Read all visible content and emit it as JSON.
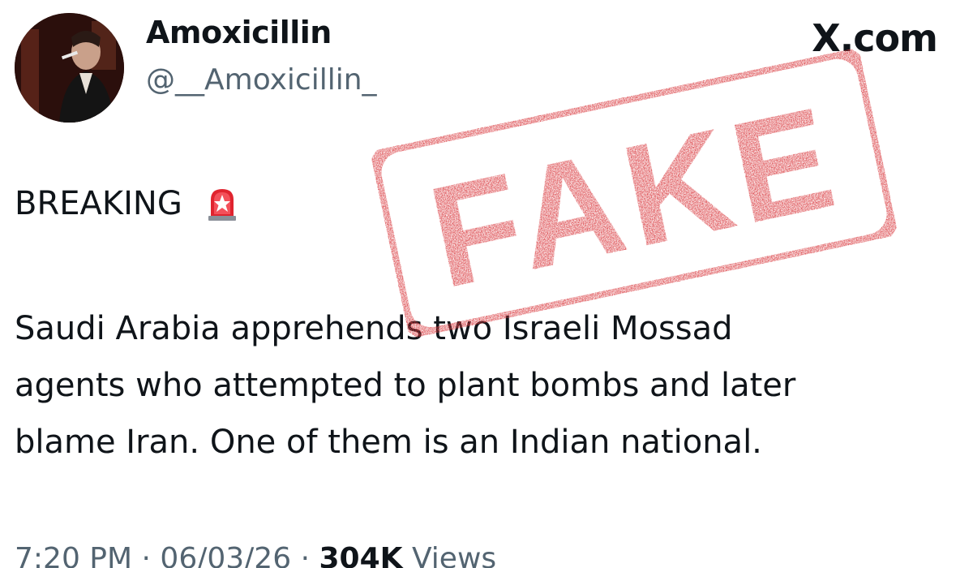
{
  "tweet": {
    "display_name": "Amoxicillin",
    "handle": "@__Amoxicillin_",
    "breaking_label": "BREAKING",
    "breaking_emoji": "siren-icon",
    "body_lines": [
      "Saudi Arabia apprehends two Israeli Mossad",
      "agents who attempted to plant bombs and later",
      "blame Iran. One of them is an Indian national."
    ],
    "time": "7:20 PM",
    "date": "06/03/26",
    "views_count": "304K",
    "views_label": "Views",
    "separator": "·"
  },
  "source": {
    "site": "X.com"
  },
  "stamp": {
    "text": "FAKE",
    "color": "#d93a3f"
  },
  "colors": {
    "text_primary": "#0f1419",
    "text_secondary": "#536471",
    "stamp_red": "#d93a3f"
  }
}
